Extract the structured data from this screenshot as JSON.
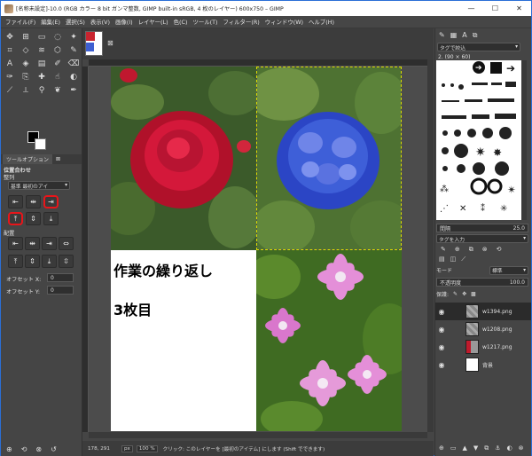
{
  "window": {
    "title": "[名称未設定]-10.0 (RGB カラー 8 bit ガンマ整数, GIMP built-in sRGB, 4 枚のレイヤー) 600x750 – GIMP",
    "minimize": "—",
    "maximize": "☐",
    "close": "✕"
  },
  "menu": [
    "ファイル(F)",
    "編集(E)",
    "選択(S)",
    "表示(V)",
    "画像(I)",
    "レイヤー(L)",
    "色(C)",
    "ツール(T)",
    "フィルター(R)",
    "ウィンドウ(W)",
    "ヘルプ(H)"
  ],
  "tool_options": {
    "tab_label": "ツールオプション",
    "section_title": "位置合わせ",
    "align_label": "整列",
    "target_label": "基準",
    "target_value": "最初のアイ",
    "distribute_label": "配置",
    "offset_x_label": "オフセット X:",
    "offset_x_value": "0",
    "offset_y_label": "オフセット Y:",
    "offset_y_value": "0"
  },
  "canvas": {
    "text_line1": "作業の繰り返し",
    "text_line2": "3枚目"
  },
  "status": {
    "coords": "178, 291",
    "unit": "px",
    "zoom": "100 %",
    "message": "クリック: このレイヤーを [最初のアイテム] にします (Shift でできます)"
  },
  "brushes": {
    "filter_placeholder": "タグで絞込",
    "brush_name": "2. (90 × 60)",
    "spacing_label": "間隔",
    "spacing_value": "25.0",
    "tag_placeholder": "タグを入力"
  },
  "layers": {
    "mode_label": "モード",
    "mode_value": "標準",
    "opacity_label": "不透明度",
    "opacity_value": "100.0",
    "lock_label": "保護:",
    "items": [
      {
        "name": "w1394.png",
        "selected": true
      },
      {
        "name": "w1208.png",
        "selected": false
      },
      {
        "name": "w1217.png",
        "selected": false
      },
      {
        "name": "背景",
        "selected": false
      }
    ]
  },
  "colors": {
    "accent_red": "#e8151a",
    "selection": "#2b2b2b"
  }
}
